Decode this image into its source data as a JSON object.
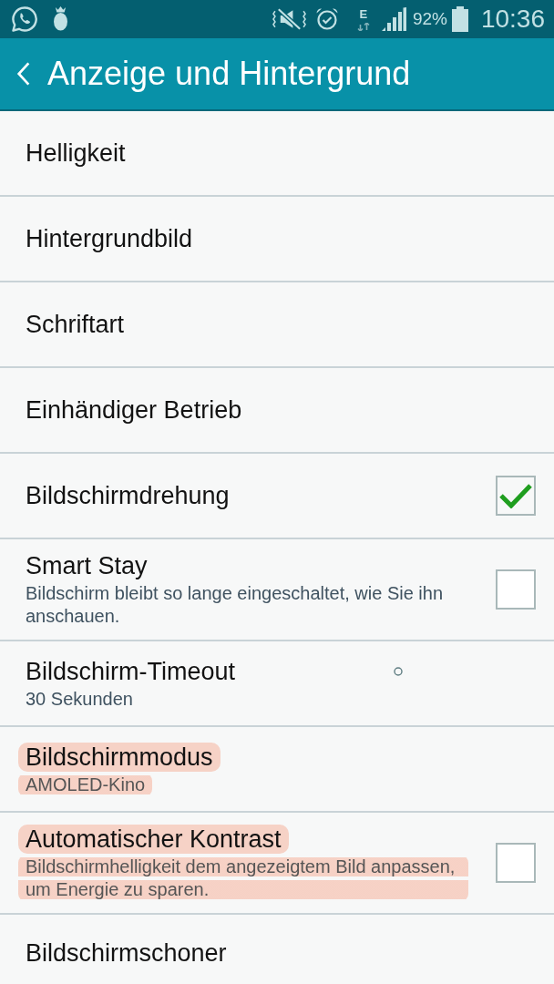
{
  "status_bar": {
    "network": "E",
    "battery": "92%",
    "time": "10:36"
  },
  "header": {
    "title": "Anzeige und Hintergrund"
  },
  "items": [
    {
      "kind": "link",
      "title": "Helligkeit",
      "highlighted": false
    },
    {
      "kind": "link",
      "title": "Hintergrundbild",
      "highlighted": false
    },
    {
      "kind": "link",
      "title": "Schriftart",
      "highlighted": false
    },
    {
      "kind": "link",
      "title": "Einhändiger Betrieb",
      "highlighted": false
    },
    {
      "kind": "checkbox",
      "title": "Bildschirmdrehung",
      "checked": true,
      "highlighted": false
    },
    {
      "kind": "checkbox",
      "title": "Smart Stay",
      "subtitle": "Bildschirm bleibt so lange eingeschaltet, wie Sie ihn anschauen.",
      "checked": false,
      "highlighted": false
    },
    {
      "kind": "link",
      "title": "Bildschirm-Timeout",
      "subtitle": "30 Sekunden",
      "highlighted": false
    },
    {
      "kind": "link",
      "title": "Bildschirmmodus",
      "subtitle": "AMOLED-Kino",
      "highlighted": true
    },
    {
      "kind": "checkbox",
      "title": "Automatischer Kontrast",
      "subtitle": "Bildschirmhelligkeit dem angezeigtem Bild anpassen, um Energie zu sparen.",
      "checked": false,
      "highlighted": true
    },
    {
      "kind": "link",
      "title": "Bildschirmschoner",
      "highlighted": false
    }
  ]
}
